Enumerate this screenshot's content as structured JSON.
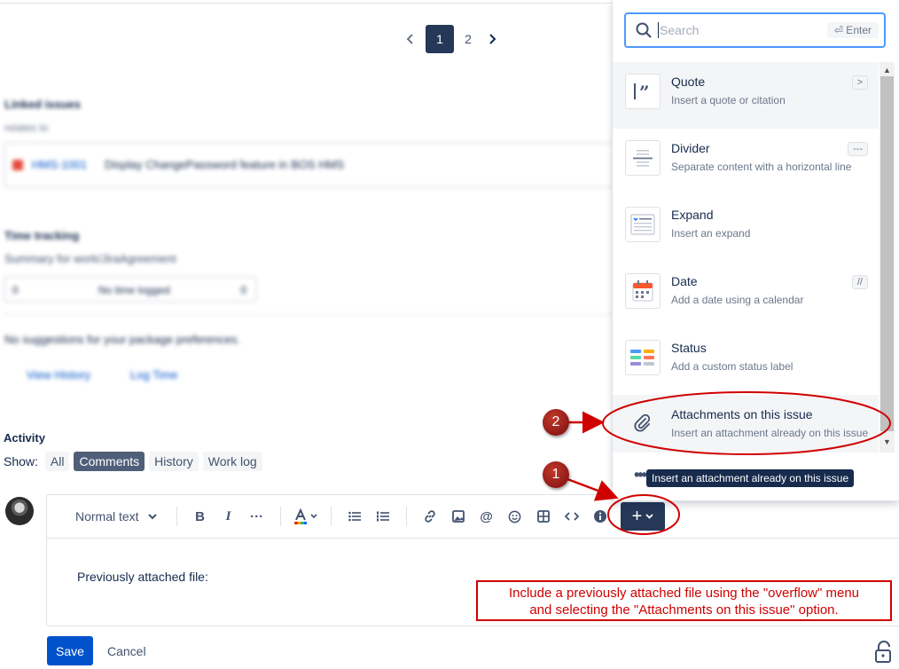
{
  "pagination": {
    "pages": [
      "1",
      "2"
    ],
    "current": "1"
  },
  "blurred": {
    "linked_title": "Linked issues",
    "linked_sub": "relates to",
    "linked_key": "HMS-1001",
    "linked_summary": "Display ChangePassword feature in BOS HMS",
    "time_title": "Time tracking",
    "time_sub": "Summary for work/JiraAgreement",
    "time_bar_left": "0",
    "time_bar_mid": "No time logged",
    "time_bar_right": "0",
    "suggest": "No suggestions for your package preferences.",
    "link1": "View History",
    "link2": "Log Time"
  },
  "activity": {
    "title": "Activity",
    "show_label": "Show:",
    "filters": [
      "All",
      "Comments",
      "History",
      "Work log"
    ],
    "active_filter": "Comments"
  },
  "editor": {
    "text_style": "Normal text",
    "content": "Previously attached file:"
  },
  "actions": {
    "save": "Save",
    "cancel": "Cancel"
  },
  "insert_menu": {
    "search_placeholder": "Search",
    "enter_hint": "⏎ Enter",
    "items": [
      {
        "title": "Quote",
        "desc": "Insert a quote or citation",
        "shortcut": ">"
      },
      {
        "title": "Divider",
        "desc": "Separate content with a horizontal line",
        "shortcut": "---"
      },
      {
        "title": "Expand",
        "desc": "Insert an expand",
        "shortcut": ""
      },
      {
        "title": "Date",
        "desc": "Add a date using a calendar",
        "shortcut": "//"
      },
      {
        "title": "Status",
        "desc": "Add a custom status label",
        "shortcut": ""
      },
      {
        "title": "Attachments on this issue",
        "desc": "Insert an attachment already on this issue",
        "shortcut": ""
      }
    ],
    "more": "•••",
    "tooltip": "Insert an attachment already on this issue"
  },
  "annotations": {
    "badge1": "1",
    "badge2": "2",
    "callout_line1": "Include a previously attached file using the \"overflow\" menu",
    "callout_line2": "and selecting the \"Attachments on this issue\" option.",
    "color": "#d00000"
  },
  "colors": {
    "primary": "#0052cc",
    "dark": "#253858",
    "focus": "#4c9aff"
  }
}
